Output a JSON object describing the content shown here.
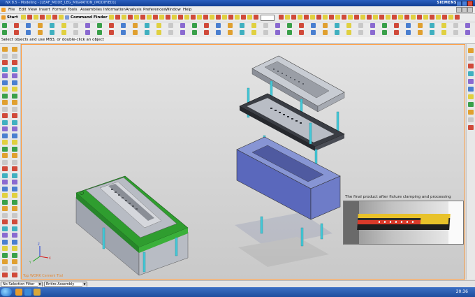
{
  "window": {
    "title": "NX 8.5 - Modeling - [LEAF_MODE_LEG_MIGRATION_(MODIFIED)]",
    "brand": "SIEMENS"
  },
  "menu": [
    "File",
    "Edit",
    "View",
    "Insert",
    "Format",
    "Tools",
    "Assemblies",
    "Information",
    "Analysis",
    "Preferences",
    "Window",
    "Help"
  ],
  "toolbar": {
    "start_label": "Start",
    "command_finder_label": "Command Finder"
  },
  "cue_line": "Select objects and use MB3, or double-click an object",
  "viewport": {
    "annotation": "The final product after fixture clamping and processing",
    "watermark": "Top WORK Cemeni Ttol"
  },
  "statusbar": {
    "selection_filter": "No Selection Filter",
    "scope": "Entire Assembly"
  },
  "taskbar": {
    "clock": "20:36"
  },
  "colors": {
    "viewport_border": "#ff9a3a",
    "fixture_green": "#2f9d2f",
    "fixture_blue": "#6878c8",
    "pin_cyan": "#44c8d8"
  }
}
